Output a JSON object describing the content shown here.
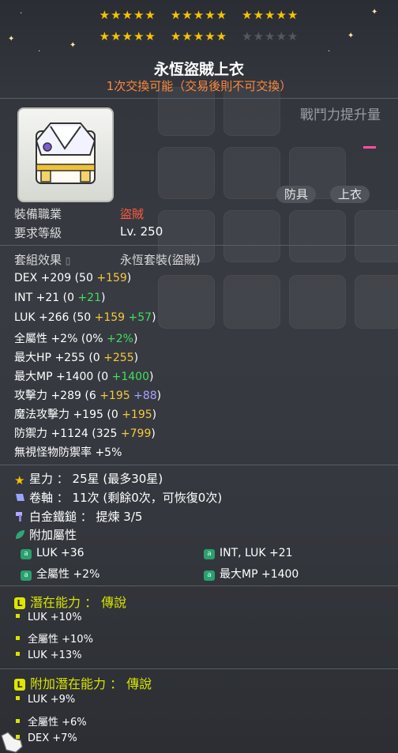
{
  "stars": {
    "row1_filled": 15,
    "row2_filled": 10,
    "row2_empty": 5,
    "color": "#f5c400"
  },
  "item": {
    "name": "永恆盜賊上衣",
    "trade_note": "1次交換可能（交易後則不可交換）",
    "combat_power_label": "戰鬥力提升量",
    "tags": [
      "防具",
      "上衣"
    ],
    "icon": "thief-top-icon"
  },
  "requirements": {
    "job_label": "裝備職業",
    "job_value": "盜賊",
    "level_label": "要求等級",
    "level_value": "Lv. 250",
    "set_label": "套組效果",
    "set_value": "永恆套裝(盜賊)"
  },
  "stats": [
    {
      "name": "DEX",
      "total": "+209",
      "open": " (50 ",
      "a": "+159",
      "b": "",
      "close": ")"
    },
    {
      "name": "INT",
      "total": "+21",
      "open": " (0 ",
      "a": "",
      "b": "+21",
      "close": ")"
    },
    {
      "name": "LUK",
      "total": "+266",
      "open": " (50 ",
      "a": "+159",
      "b": " +57",
      "close": ")"
    },
    {
      "name": "全屬性",
      "total": "+2%",
      "open": " (0% ",
      "a": "",
      "b": "+2%",
      "close": ")"
    },
    {
      "name": "最大HP",
      "total": "+255",
      "open": " (0 ",
      "a": "+255",
      "b": "",
      "close": ")"
    },
    {
      "name": "最大MP",
      "total": "+1400",
      "open": " (0 ",
      "a": "",
      "b": "+1400",
      "close": ")"
    },
    {
      "name": "攻擊力",
      "total": "+289",
      "open": " (6 ",
      "a": "+195",
      "b": " +88",
      "close": ")"
    },
    {
      "name": "魔法攻擊力",
      "total": "+195",
      "open": " (0 ",
      "a": "+195",
      "b": "",
      "close": ")"
    },
    {
      "name": "防禦力",
      "total": "+1124",
      "open": " (325 ",
      "a": "+799",
      "b": "",
      "close": ")"
    },
    {
      "name": "無視怪物防禦率",
      "total": "+5%",
      "open": "",
      "a": "",
      "b": "",
      "close": ""
    }
  ],
  "enhance": {
    "star_force": "星力 ： 25星 (最多30星)",
    "scroll": "卷軸 ： 11次 (剩餘0次，可恢復0次)",
    "hammer": "白金鐵鎚 ： 提煉 3/5",
    "additional_label": "附加屬性"
  },
  "additional": [
    {
      "text": "LUK  +36"
    },
    {
      "text": "INT, LUK  +21"
    },
    {
      "text": "全屬性 +2%"
    },
    {
      "text": "最大MP  +1400"
    }
  ],
  "potential": {
    "title": "潛在能力 ： 傳說",
    "lines": [
      "LUK +10%",
      "全屬性 +10%",
      "LUK +13%"
    ]
  },
  "bonus_potential": {
    "title": "附加潛在能力 ： 傳說",
    "lines": [
      "LUK +9%",
      "全屬性 +6%",
      "DEX +7%"
    ]
  }
}
